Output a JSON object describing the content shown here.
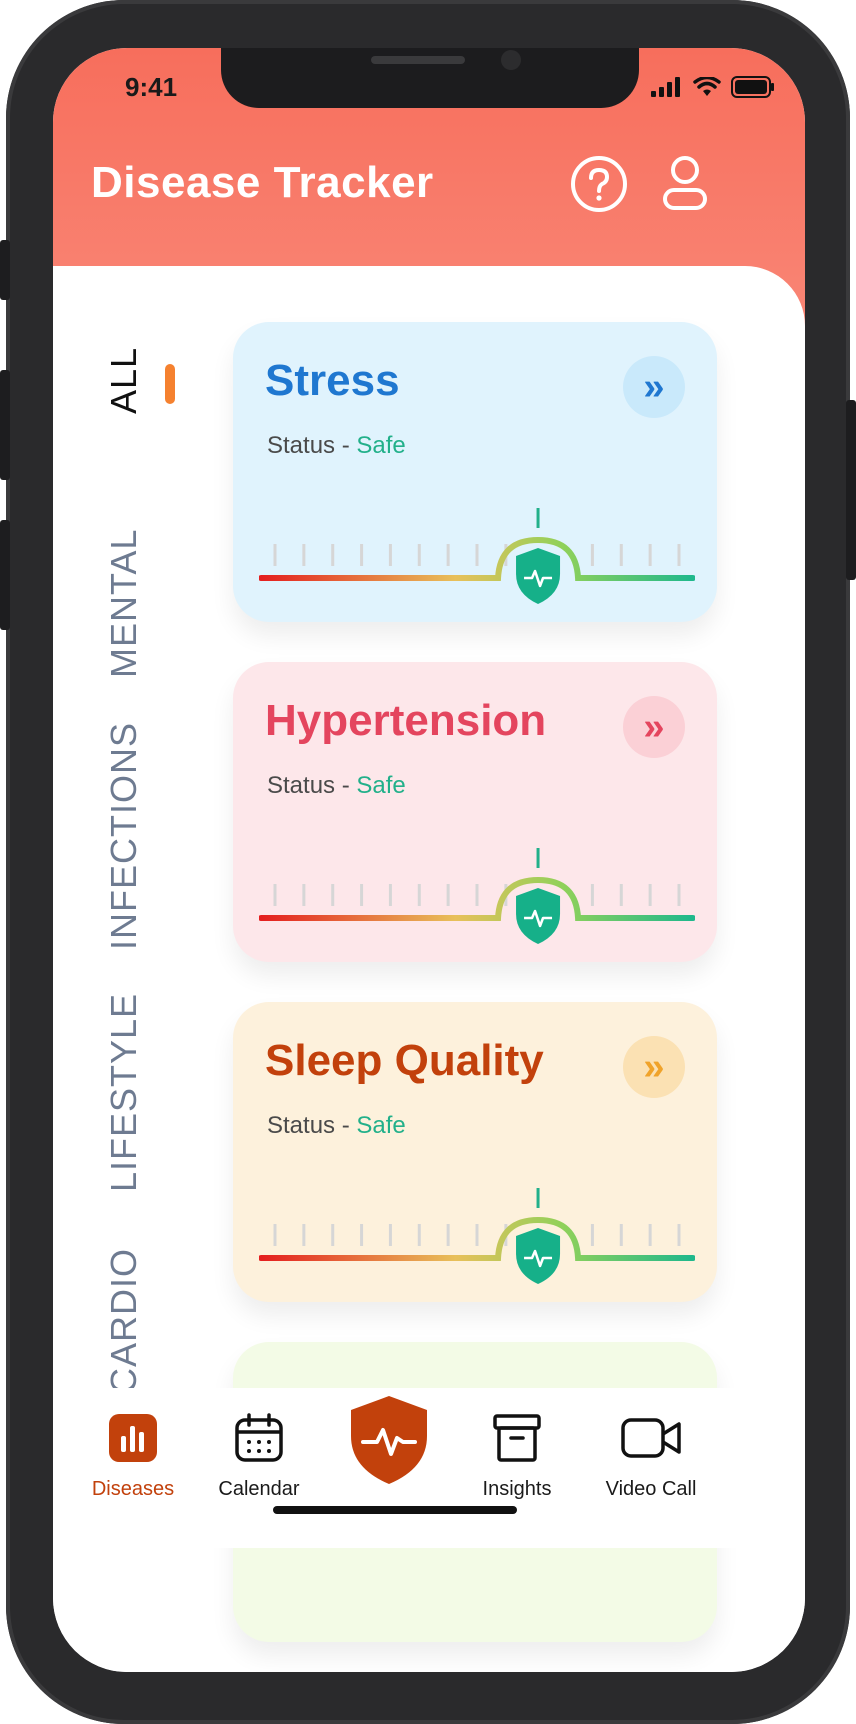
{
  "status_bar": {
    "time": "9:41"
  },
  "header": {
    "title": "Disease Tracker"
  },
  "categories": [
    "ALL",
    "MENTAL",
    "INFECTIONS",
    "LIFESTYLE",
    "CARDIO"
  ],
  "active_category": "ALL",
  "cards": [
    {
      "title": "Stress",
      "status_label": "Status -",
      "status_value": "Safe",
      "gauge_level": 0.64,
      "title_color": "#1f77d0",
      "bg": "#e0f3fd",
      "btn_bg": "#c9e9fb",
      "btn_color": "#1f77d0"
    },
    {
      "title": "Hypertension",
      "status_label": "Status -",
      "status_value": "Safe",
      "gauge_level": 0.64,
      "title_color": "#e4455e",
      "bg": "#fde7ea",
      "btn_bg": "#fbd0d6",
      "btn_color": "#e4455e"
    },
    {
      "title": "Sleep Quality",
      "status_label": "Status -",
      "status_value": "Safe",
      "gauge_level": 0.64,
      "title_color": "#c2410c",
      "bg": "#fdf1dc",
      "btn_bg": "#fbe1b3",
      "btn_color": "#f0a32a"
    }
  ],
  "bottom_nav": {
    "diseases": "Diseases",
    "calendar": "Calendar",
    "insights": "Insights",
    "video_call": "Video Call"
  },
  "colors": {
    "accent": "#f76e5c",
    "active_nav": "#c2410c",
    "safe": "#22b08a"
  },
  "icons": [
    "signal-icon",
    "wifi-icon",
    "battery-icon",
    "help-icon",
    "profile-icon",
    "chevron-double-right-icon",
    "shield-pulse-icon",
    "bar-chart-icon",
    "calendar-icon",
    "archive-box-icon",
    "video-camera-icon"
  ]
}
